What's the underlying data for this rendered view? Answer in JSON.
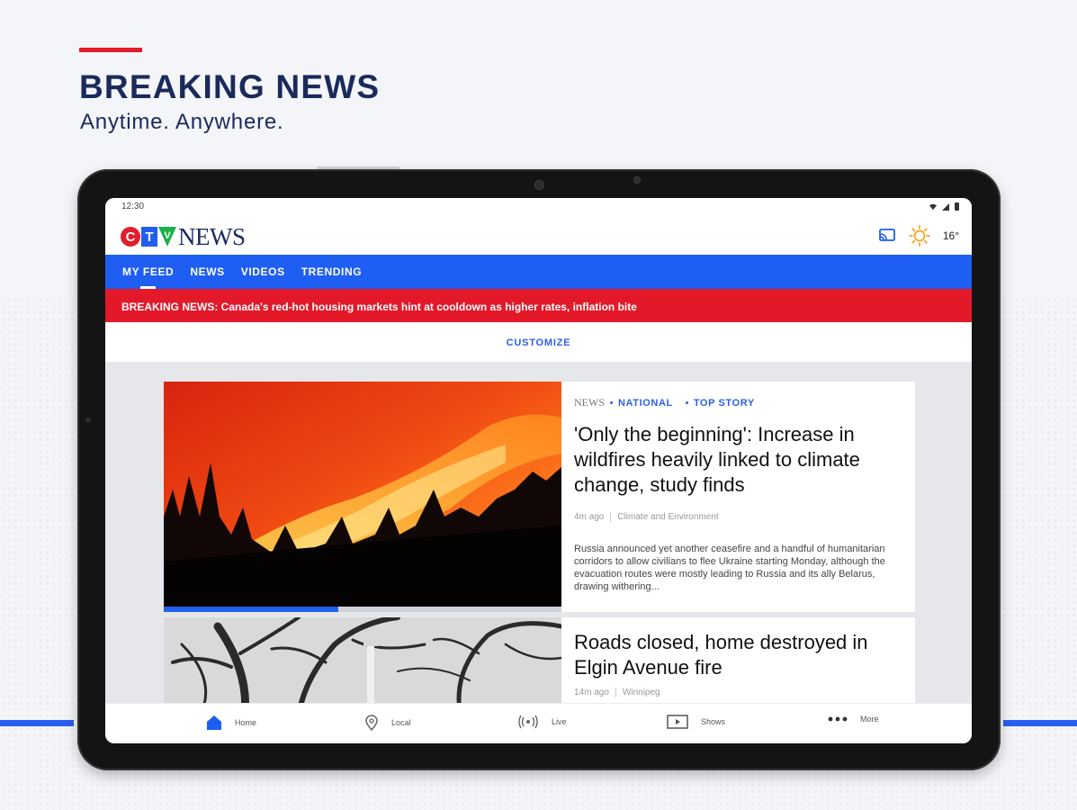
{
  "promo": {
    "title": "BREAKING NEWS",
    "subtitle": "Anytime. Anywhere."
  },
  "statusbar": {
    "time": "12:30"
  },
  "appbar": {
    "logo_brand": "CTV",
    "logo_word": "NEWS",
    "temperature": "16°",
    "icons": [
      "cast-icon",
      "weather-sun-icon"
    ]
  },
  "tabs": [
    {
      "label": "MY FEED",
      "active": true
    },
    {
      "label": "NEWS",
      "active": false
    },
    {
      "label": "VIDEOS",
      "active": false
    },
    {
      "label": "TRENDING",
      "active": false
    }
  ],
  "breaking": {
    "text": "BREAKING NEWS: Canada's red-hot housing markets hint at cooldown as higher rates, inflation bite"
  },
  "customize": {
    "label": "CUSTOMIZE"
  },
  "stories": [
    {
      "source": "NEWS",
      "section": "NATIONAL",
      "tag": "TOP STORY",
      "title": "'Only the beginning': Increase in wildfires heavily linked to climate change, study finds",
      "time": "4m ago",
      "category": "Climate and Environment",
      "summary": "Russia announced yet another ceasefire and a handful of humanitarian corridors to allow civilians to flee Ukraine starting Monday, although the evacuation routes were mostly leading to Russia and its ally Belarus, drawing withering...",
      "progress": 0.44
    },
    {
      "title": "Roads closed, home destroyed in Elgin Avenue fire",
      "time": "14m ago",
      "category": "Winnipeg"
    }
  ],
  "bottom_nav": [
    {
      "label": "Home",
      "icon": "home-icon",
      "active": true
    },
    {
      "label": "Local",
      "icon": "location-pin-icon",
      "active": false
    },
    {
      "label": "Live",
      "icon": "live-broadcast-icon",
      "active": false
    },
    {
      "label": "Shows",
      "icon": "play-box-icon",
      "active": false
    },
    {
      "label": "More",
      "icon": "more-dots-icon",
      "active": false
    }
  ],
  "colors": {
    "brand_blue": "#1f5ef2",
    "breaking_red": "#e3192a",
    "navy": "#1a2a5c"
  }
}
